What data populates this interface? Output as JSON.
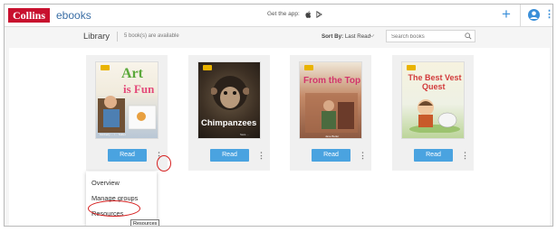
{
  "brand": {
    "logo": "Collins",
    "product": "ebooks"
  },
  "header": {
    "get_app_label": "Get the app:",
    "apple_icon": "apple-icon",
    "play_icon": "google-play-icon",
    "add_icon": "plus-icon",
    "account_icon": "account-circle-icon",
    "more_icon": "kebab-menu-icon"
  },
  "library": {
    "title": "Library",
    "count_text": "5 book(s) are available",
    "sort_label": "Sort By:",
    "sort_value": "Last Read",
    "search_placeholder": "Search books"
  },
  "books": [
    {
      "title_line1": "Art",
      "title_line2": "is Fun",
      "read_label": "Read",
      "authors": "Kimberly ... / ... Sutter"
    },
    {
      "title_line1": "Chimpanzees",
      "title_line2": "",
      "read_label": "Read",
      "authors": "Sara ..."
    },
    {
      "title_line1": "From the Top",
      "title_line2": "",
      "read_label": "Read",
      "authors": "Jane Butler"
    },
    {
      "title_line1": "The Best Vest",
      "title_line2": "Quest",
      "read_label": "Read",
      "authors": ""
    }
  ],
  "menu": {
    "items": [
      "Overview",
      "Manage groups",
      "Resources"
    ],
    "tooltip": "Resources"
  },
  "colors": {
    "brand_red": "#c8102e",
    "accent_blue": "#4aa3e0",
    "annotation_red": "#d62020"
  }
}
